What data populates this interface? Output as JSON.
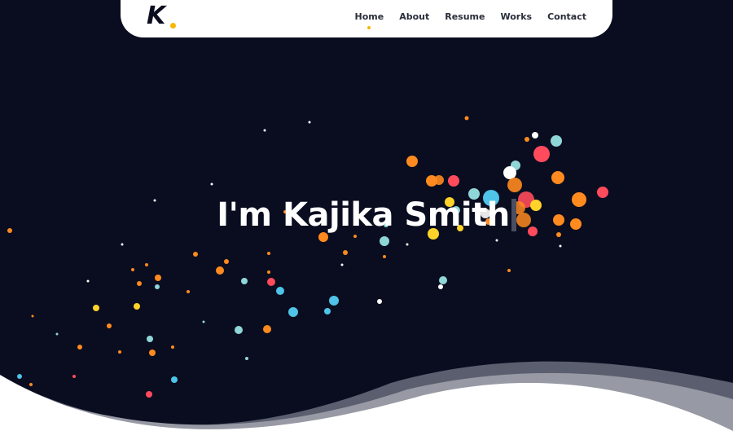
{
  "logo": {
    "letter": "K",
    "dot_color": "#f5b800"
  },
  "nav": {
    "items": [
      {
        "label": "Home",
        "active": true
      },
      {
        "label": "About",
        "active": false
      },
      {
        "label": "Resume",
        "active": false
      },
      {
        "label": "Works",
        "active": false
      },
      {
        "label": "Contact",
        "active": false
      }
    ]
  },
  "hero": {
    "headline": "I'm Kajika Smith",
    "background_color": "#0a0d1f",
    "particle_colors": [
      "#ff8a1f",
      "#ff4b5c",
      "#8fd6d8",
      "#4fc3e8",
      "#ffd32a",
      "#ffffff"
    ]
  }
}
